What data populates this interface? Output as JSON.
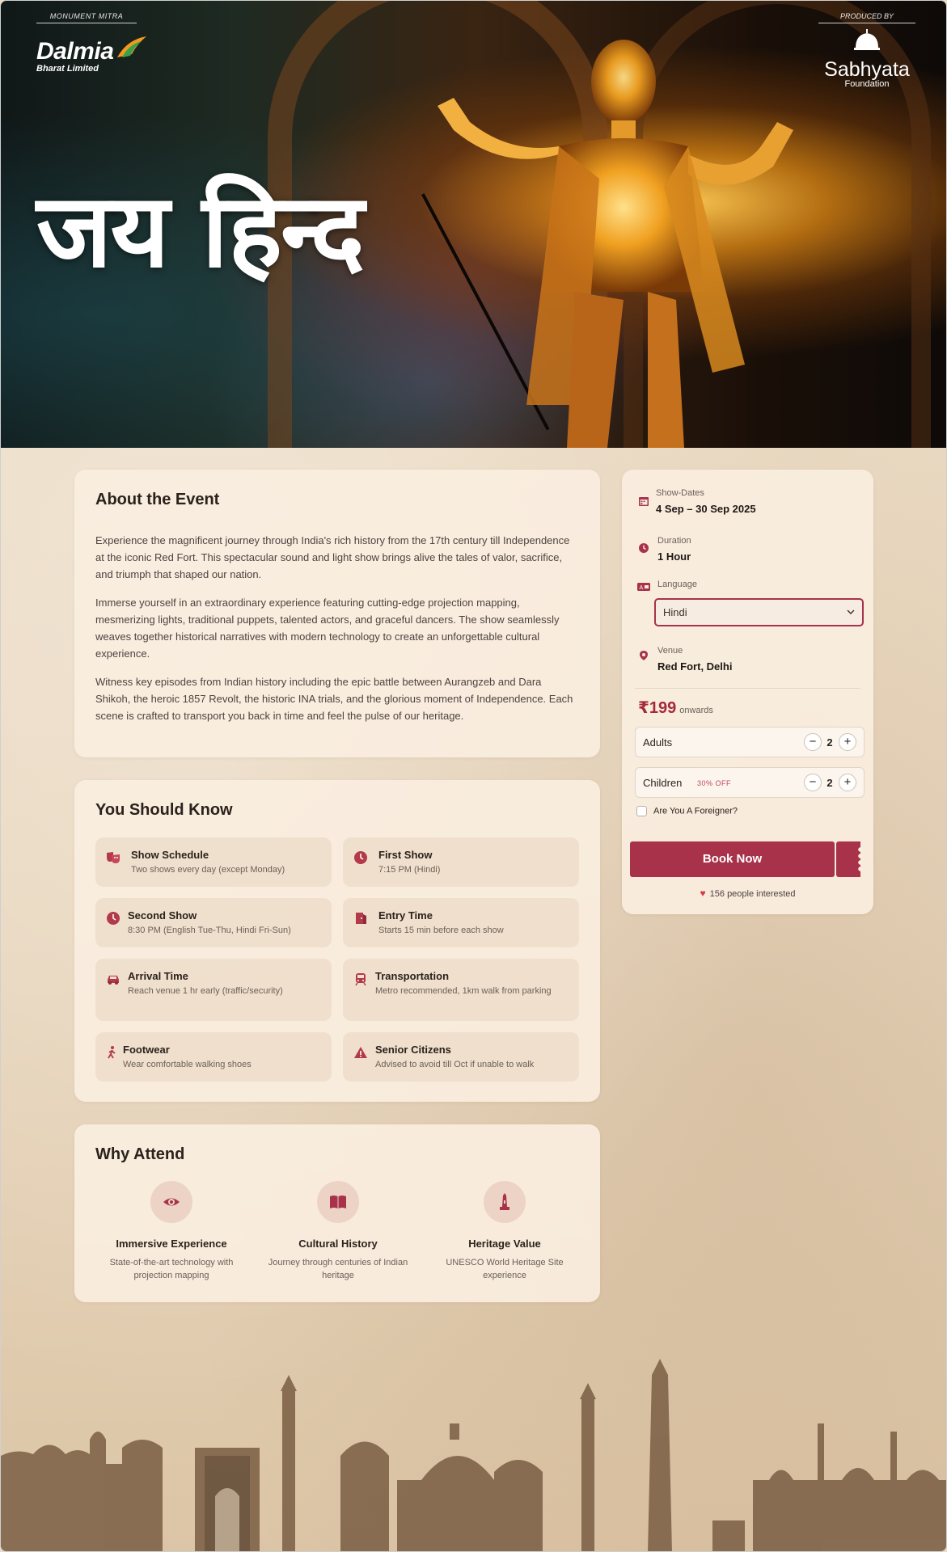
{
  "hero": {
    "title": "जय हिन्द",
    "left_brand": {
      "tag": "MONUMENT MITRA",
      "name": "Dalmia",
      "sub": "Bharat Limited"
    },
    "right_brand": {
      "tag": "PRODUCED BY",
      "name": "Sabhyata",
      "sub": "Foundation"
    }
  },
  "about": {
    "heading": "About the Event",
    "paragraphs": [
      "Experience the magnificent journey through India's rich history from the 17th century till Independence at the iconic Red Fort. This spectacular sound and light show brings alive the tales of valor, sacrifice, and triumph that shaped our nation.",
      "Immerse yourself in an extraordinary experience featuring cutting-edge projection mapping, mesmerizing lights, traditional puppets, talented actors, and graceful dancers. The show seamlessly weaves together historical narratives with modern technology to create an unforgettable cultural experience.",
      "Witness key episodes from Indian history including the epic battle between Aurangzeb and Dara Shikoh, the heroic 1857 Revolt, the historic INA trials, and the glorious moment of Independence. Each scene is crafted to transport you back in time and feel the pulse of our heritage."
    ]
  },
  "know": {
    "heading": "You Should Know",
    "items": [
      {
        "icon": "theater-masks-icon",
        "title": "Show Schedule",
        "desc": "Two shows every day (except Monday)"
      },
      {
        "icon": "clock-icon",
        "title": "First Show",
        "desc": "7:15 PM (Hindi)"
      },
      {
        "icon": "clock-icon",
        "title": "Second Show",
        "desc": "8:30 PM (English Tue-Thu, Hindi Fri-Sun)"
      },
      {
        "icon": "door-icon",
        "title": "Entry Time",
        "desc": "Starts 15 min before each show"
      },
      {
        "icon": "car-icon",
        "title": "Arrival Time",
        "desc": "Reach venue 1 hr early (traffic/security)"
      },
      {
        "icon": "train-icon",
        "title": "Transportation",
        "desc": "Metro recommended, 1km walk from parking"
      },
      {
        "icon": "walking-icon",
        "title": "Footwear",
        "desc": "Wear comfortable walking shoes"
      },
      {
        "icon": "warning-icon",
        "title": "Senior Citizens",
        "desc": "Advised to avoid till Oct if unable to walk"
      }
    ]
  },
  "why": {
    "heading": "Why Attend",
    "items": [
      {
        "icon": "eye-icon",
        "title": "Immersive Experience",
        "desc": "State-of-the-art technology with projection mapping"
      },
      {
        "icon": "book-icon",
        "title": "Cultural History",
        "desc": "Journey through centuries of Indian heritage"
      },
      {
        "icon": "monument-icon",
        "title": "Heritage Value",
        "desc": "UNESCO World Heritage Site experience"
      }
    ]
  },
  "booking": {
    "dates_label": "Show-Dates",
    "dates_value": "4 Sep – 30 Sep 2025",
    "duration_label": "Duration",
    "duration_value": "1 Hour",
    "language_label": "Language",
    "language_value": "Hindi",
    "venue_label": "Venue",
    "venue_value": "Red Fort, Delhi",
    "price": "₹199",
    "price_suffix": "onwards",
    "adults_label": "Adults",
    "adults_count": "2",
    "children_label": "Children",
    "children_discount": "30% OFF",
    "children_count": "2",
    "foreigner_label": "Are You A Foreigner?",
    "book_label": "Book Now",
    "interest_text": "156 people interested",
    "accent": "#a8324a"
  }
}
